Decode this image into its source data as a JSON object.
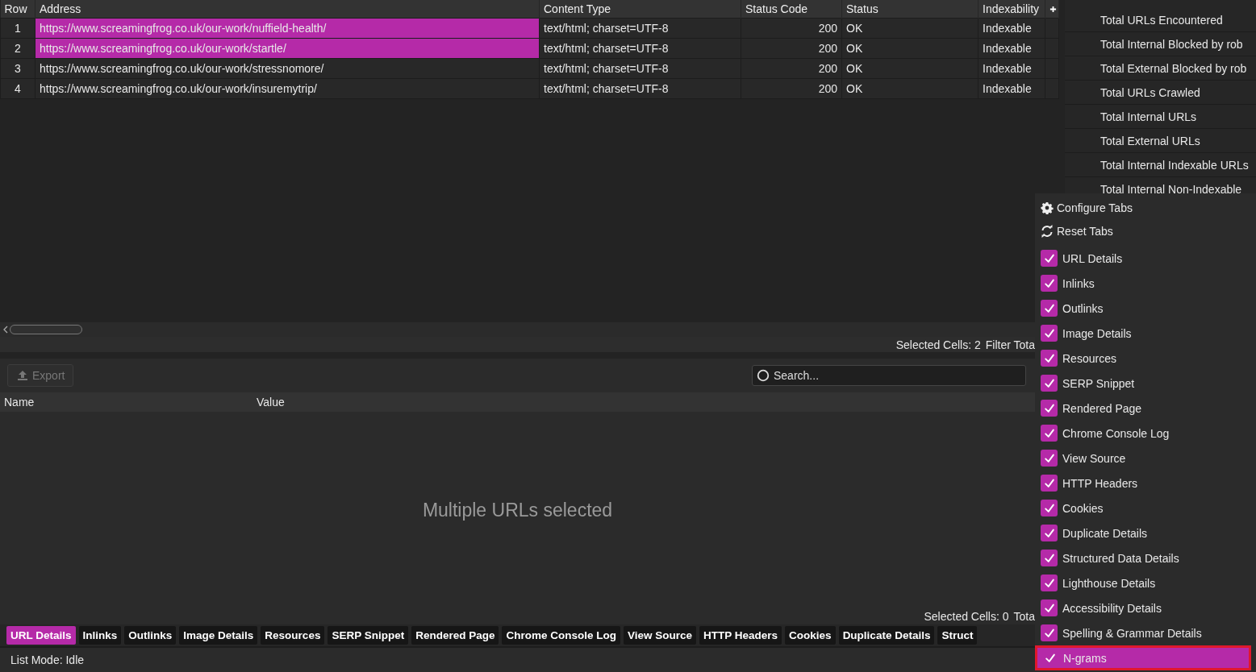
{
  "table": {
    "columns": [
      "Row",
      "Address",
      "Content Type",
      "Status Code",
      "Status",
      "Indexability"
    ],
    "rows": [
      {
        "row": "1",
        "address": "https://www.screamingfrog.co.uk/our-work/nuffield-health/",
        "content_type": "text/html; charset=UTF-8",
        "status_code": "200",
        "status": "OK",
        "indexability": "Indexable",
        "selected": true
      },
      {
        "row": "2",
        "address": "https://www.screamingfrog.co.uk/our-work/startle/",
        "content_type": "text/html; charset=UTF-8",
        "status_code": "200",
        "status": "OK",
        "indexability": "Indexable",
        "selected": true
      },
      {
        "row": "3",
        "address": "https://www.screamingfrog.co.uk/our-work/stressnomore/",
        "content_type": "text/html; charset=UTF-8",
        "status_code": "200",
        "status": "OK",
        "indexability": "Indexable",
        "selected": false
      },
      {
        "row": "4",
        "address": "https://www.screamingfrog.co.uk/our-work/insuremytrip/",
        "content_type": "text/html; charset=UTF-8",
        "status_code": "200",
        "status": "OK",
        "indexability": "Indexable",
        "selected": false
      }
    ],
    "selection_status": "Selected Cells: 2",
    "filter_status": "Filter Tota"
  },
  "overview": {
    "items": [
      "Total URLs Encountered",
      "Total Internal Blocked by rob",
      "Total External Blocked by rob",
      "Total URLs Crawled",
      "Total Internal URLs",
      "Total External URLs",
      "Total Internal Indexable URLs",
      "Total Internal Non-Indexable"
    ]
  },
  "details": {
    "export_button": {
      "label": "Export",
      "disabled": true
    },
    "search": {
      "placeholder": "Search..."
    },
    "columns": [
      "Name",
      "Value"
    ],
    "empty_message": "Multiple URLs selected",
    "selection_status": "Selected Cells: 0",
    "total_status": "Tota"
  },
  "tabs": [
    {
      "label": "URL Details",
      "selected": true
    },
    {
      "label": "Inlinks",
      "selected": false
    },
    {
      "label": "Outlinks",
      "selected": false
    },
    {
      "label": "Image Details",
      "selected": false
    },
    {
      "label": "Resources",
      "selected": false
    },
    {
      "label": "SERP Snippet",
      "selected": false
    },
    {
      "label": "Rendered Page",
      "selected": false
    },
    {
      "label": "Chrome Console Log",
      "selected": false
    },
    {
      "label": "View Source",
      "selected": false
    },
    {
      "label": "HTTP Headers",
      "selected": false
    },
    {
      "label": "Cookies",
      "selected": false
    },
    {
      "label": "Duplicate Details",
      "selected": false
    },
    {
      "label": "Struct",
      "selected": false
    }
  ],
  "status_bar": "List Mode: Idle",
  "tab_menu": {
    "actions": [
      {
        "kind": "configure",
        "label": "Configure Tabs"
      },
      {
        "kind": "reset",
        "label": "Reset Tabs"
      }
    ],
    "items": [
      {
        "label": "URL Details",
        "checked": true,
        "selected": false
      },
      {
        "label": "Inlinks",
        "checked": true,
        "selected": false
      },
      {
        "label": "Outlinks",
        "checked": true,
        "selected": false
      },
      {
        "label": "Image Details",
        "checked": true,
        "selected": false
      },
      {
        "label": "Resources",
        "checked": true,
        "selected": false
      },
      {
        "label": "SERP Snippet",
        "checked": true,
        "selected": false
      },
      {
        "label": "Rendered Page",
        "checked": true,
        "selected": false
      },
      {
        "label": "Chrome Console Log",
        "checked": true,
        "selected": false
      },
      {
        "label": "View Source",
        "checked": true,
        "selected": false
      },
      {
        "label": "HTTP Headers",
        "checked": true,
        "selected": false
      },
      {
        "label": "Cookies",
        "checked": true,
        "selected": false
      },
      {
        "label": "Duplicate Details",
        "checked": true,
        "selected": false
      },
      {
        "label": "Structured Data Details",
        "checked": true,
        "selected": false
      },
      {
        "label": "Lighthouse Details",
        "checked": true,
        "selected": false
      },
      {
        "label": "Accessibility Details",
        "checked": true,
        "selected": false
      },
      {
        "label": "Spelling & Grammar Details",
        "checked": true,
        "selected": false
      },
      {
        "label": "N-grams",
        "checked": true,
        "selected": true
      }
    ]
  }
}
